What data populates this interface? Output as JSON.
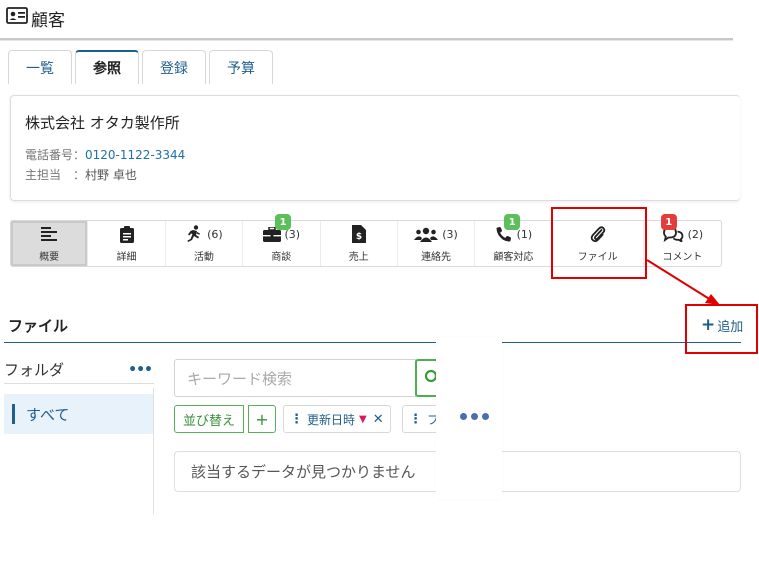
{
  "header": {
    "title": "顧客"
  },
  "tabs": [
    {
      "label": "一覧",
      "active": false
    },
    {
      "label": "参照",
      "active": true
    },
    {
      "label": "登録",
      "active": false
    },
    {
      "label": "予算",
      "active": false
    }
  ],
  "customer": {
    "company_name": "株式会社 オタカ製作所",
    "phone_label": "電話番号：",
    "phone": "0120-1122-3344",
    "owner_label": "主担当　：",
    "owner": "村野 卓也"
  },
  "toolbar": {
    "items": [
      {
        "icon": "list-icon",
        "label": "概要",
        "count": "",
        "badge": ""
      },
      {
        "icon": "clipboard-icon",
        "label": "詳細",
        "count": "",
        "badge": ""
      },
      {
        "icon": "running-icon",
        "label": "活動",
        "count": "(6)",
        "badge": ""
      },
      {
        "icon": "briefcase-icon",
        "label": "商談",
        "count": "(3)",
        "badge": "1"
      },
      {
        "icon": "invoice-icon",
        "label": "売上",
        "count": "",
        "badge": ""
      },
      {
        "icon": "users-icon",
        "label": "連絡先",
        "count": "(3)",
        "badge": ""
      },
      {
        "icon": "phone-icon",
        "label": "顧客対応",
        "count": "(1)",
        "badge": "1"
      },
      {
        "icon": "paperclip-icon",
        "label": "ファイル",
        "count": "",
        "badge": ""
      },
      {
        "icon": "comments-icon",
        "label": "コメント",
        "count": "(2)",
        "badge": "1"
      }
    ]
  },
  "section": {
    "title": "ファイル",
    "add_label": "追加"
  },
  "folders": {
    "title": "フォルダ",
    "items": [
      "すべて"
    ]
  },
  "search": {
    "placeholder": "キーワード検索"
  },
  "sort": {
    "button_label": "並び替え",
    "add_symbol": "+",
    "chip_label": "更新日時",
    "chip2_label": "フ"
  },
  "empty_message": "該当するデータが見つかりません",
  "colors": {
    "accent": "#1f5f8b",
    "highlight": "#e00000",
    "badge_green": "#5cc05a",
    "badge_red": "#e23c3c",
    "sort_green": "#5aaf5a"
  }
}
